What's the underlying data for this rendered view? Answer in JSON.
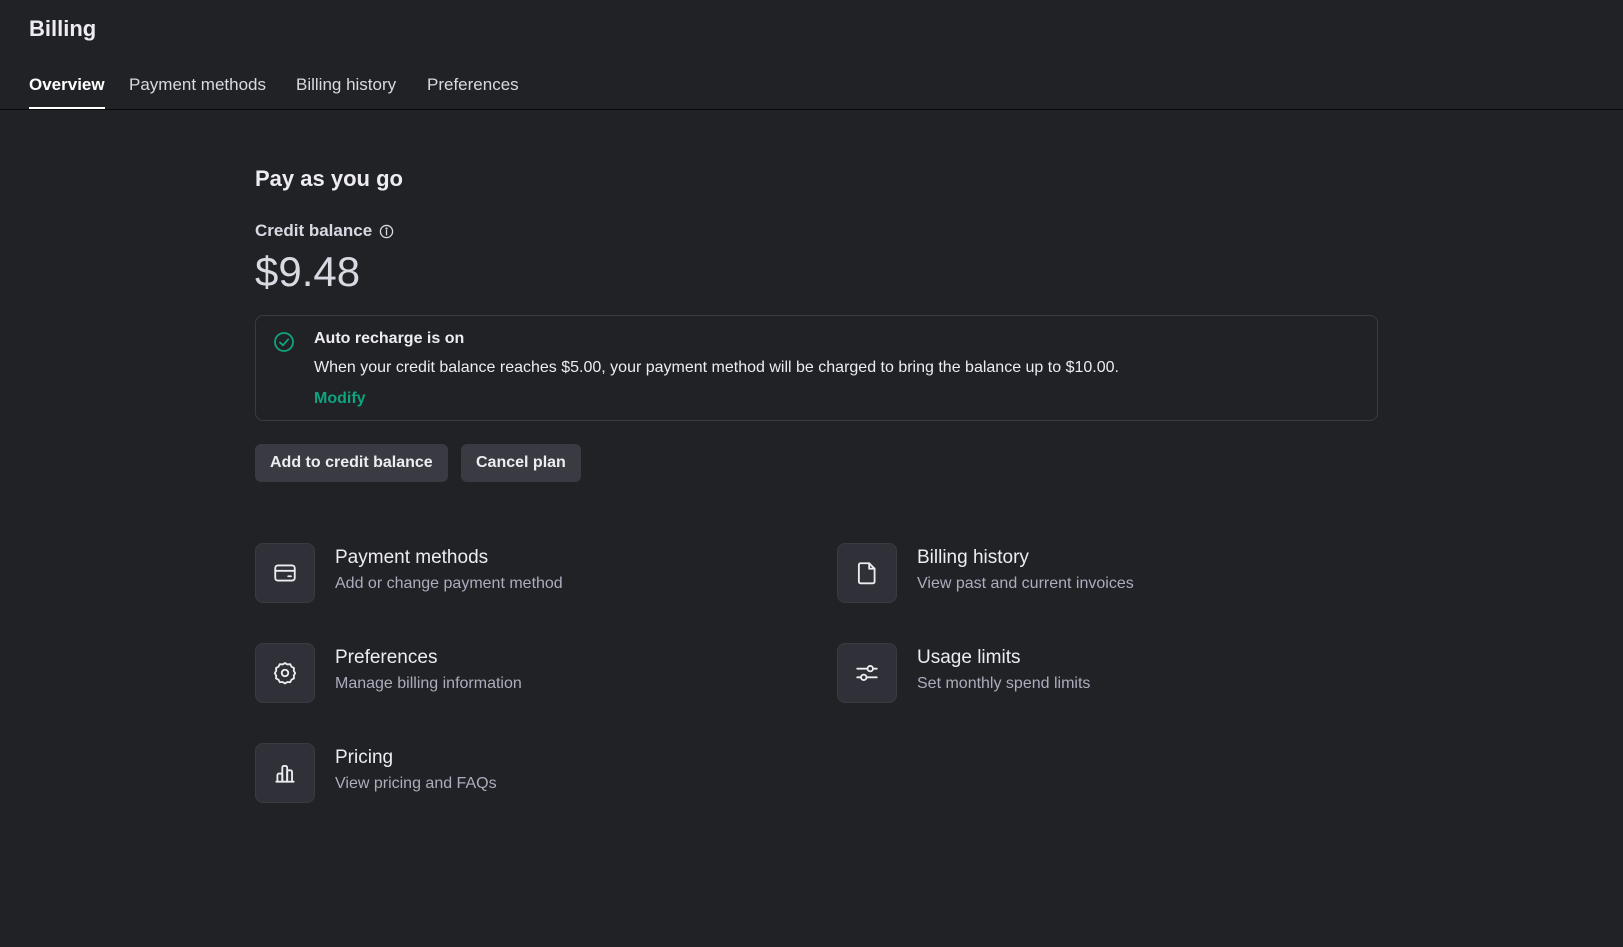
{
  "header": {
    "title": "Billing"
  },
  "tabs": [
    {
      "label": "Overview",
      "active": true
    },
    {
      "label": "Payment methods",
      "active": false
    },
    {
      "label": "Billing history",
      "active": false
    },
    {
      "label": "Preferences",
      "active": false
    }
  ],
  "plan": {
    "title": "Pay as you go",
    "balance_label": "Credit balance",
    "balance_value": "$9.48"
  },
  "auto_recharge": {
    "title": "Auto recharge is on",
    "description": "When your credit balance reaches $5.00, your payment method will be charged to bring the balance up to $10.00.",
    "modify_label": "Modify"
  },
  "actions": {
    "add_credit_label": "Add to credit balance",
    "cancel_plan_label": "Cancel plan"
  },
  "cards": [
    {
      "icon": "credit-card-icon",
      "title": "Payment methods",
      "subtitle": "Add or change payment method"
    },
    {
      "icon": "document-icon",
      "title": "Billing history",
      "subtitle": "View past and current invoices"
    },
    {
      "icon": "gear-icon",
      "title": "Preferences",
      "subtitle": "Manage billing information"
    },
    {
      "icon": "sliders-icon",
      "title": "Usage limits",
      "subtitle": "Set monthly spend limits"
    },
    {
      "icon": "bar-chart-icon",
      "title": "Pricing",
      "subtitle": "View pricing and FAQs"
    }
  ],
  "colors": {
    "background": "#212225",
    "accent": "#10a37f",
    "button": "#3a3b42",
    "border": "#3a3b40"
  }
}
